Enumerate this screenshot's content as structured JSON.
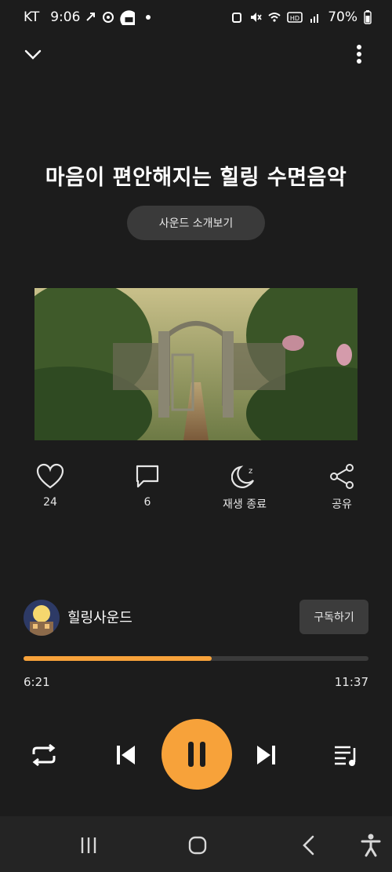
{
  "status_bar": {
    "carrier": "KT",
    "time": "9:06",
    "battery": "70%"
  },
  "player": {
    "title": "마음이 편안해지는 힐링 수면음악",
    "intro_button": "사운드 소개보기",
    "actions": {
      "like_count": "24",
      "comment_count": "6",
      "sleep_timer_label": "재생 종료",
      "share_label": "공유"
    },
    "channel": {
      "name": "힐링사운드",
      "subscribe_label": "구독하기"
    },
    "progress": {
      "elapsed": "6:21",
      "total": "11:37",
      "fraction": 0.546
    }
  },
  "colors": {
    "background": "#1c1c1c",
    "accent": "#f7a23a",
    "button_bg": "#3a3a3a"
  }
}
